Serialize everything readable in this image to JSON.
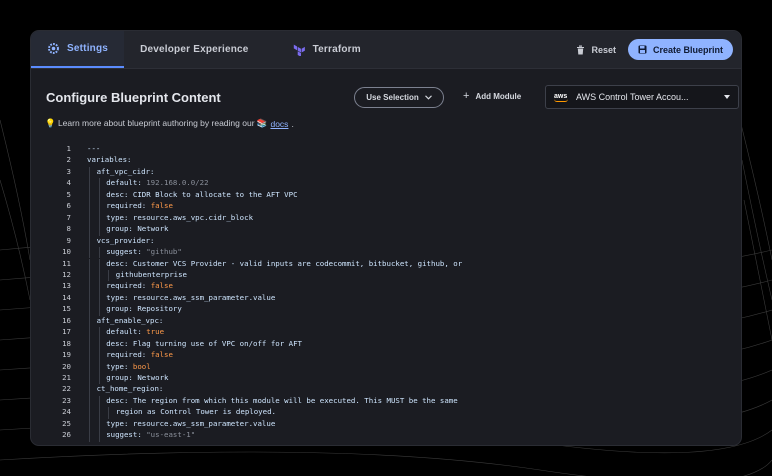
{
  "tabs": [
    {
      "label": "Settings",
      "icon": "gear-icon",
      "active": true
    },
    {
      "label": "Developer Experience",
      "icon": "",
      "active": false
    },
    {
      "label": "Terraform",
      "icon": "terraform-icon",
      "active": false
    }
  ],
  "actions": {
    "reset_label": "Reset",
    "create_label": "Create Blueprint"
  },
  "header": {
    "title": "Configure Blueprint Content",
    "use_selection_label": "Use Selection",
    "add_module_label": "Add Module",
    "module_selected": "AWS Control Tower Accou...",
    "module_logo_text": "aws"
  },
  "info": {
    "prefix": "💡 Learn more about blueprint authoring by reading our 📚",
    "link": "docs",
    "suffix": "."
  },
  "code_lines": [
    {
      "n": "1",
      "indent": 0,
      "parts": [
        [
          "k",
          "---"
        ]
      ]
    },
    {
      "n": "2",
      "indent": 0,
      "parts": [
        [
          "k",
          "variables:"
        ]
      ]
    },
    {
      "n": "3",
      "indent": 1,
      "parts": [
        [
          "k",
          "aft_vpc_cidr:"
        ]
      ]
    },
    {
      "n": "4",
      "indent": 2,
      "parts": [
        [
          "k",
          "default: "
        ],
        [
          "s",
          "192.168.0.0/22"
        ]
      ]
    },
    {
      "n": "5",
      "indent": 2,
      "parts": [
        [
          "k",
          "desc: CIDR Block to allocate to the AFT VPC"
        ]
      ]
    },
    {
      "n": "6",
      "indent": 2,
      "parts": [
        [
          "k",
          "required: "
        ],
        [
          "b",
          "false"
        ]
      ]
    },
    {
      "n": "7",
      "indent": 2,
      "parts": [
        [
          "k",
          "type: resource.aws_vpc.cidr_block"
        ]
      ]
    },
    {
      "n": "8",
      "indent": 2,
      "parts": [
        [
          "k",
          "group: Network"
        ]
      ]
    },
    {
      "n": "9",
      "indent": 1,
      "parts": [
        [
          "k",
          "vcs_provider:"
        ]
      ]
    },
    {
      "n": "10",
      "indent": 2,
      "parts": [
        [
          "k",
          "suggest: "
        ],
        [
          "s",
          "\"github\""
        ]
      ]
    },
    {
      "n": "11",
      "indent": 2,
      "parts": [
        [
          "k",
          "desc: Customer VCS Provider - valid inputs are codecommit, bitbucket, github, or"
        ]
      ]
    },
    {
      "n": "12",
      "indent": 3,
      "parts": [
        [
          "k",
          "githubenterprise"
        ]
      ]
    },
    {
      "n": "13",
      "indent": 2,
      "parts": [
        [
          "k",
          "required: "
        ],
        [
          "b",
          "false"
        ]
      ]
    },
    {
      "n": "14",
      "indent": 2,
      "parts": [
        [
          "k",
          "type: resource.aws_ssm_parameter.value"
        ]
      ]
    },
    {
      "n": "15",
      "indent": 2,
      "parts": [
        [
          "k",
          "group: Repository"
        ]
      ]
    },
    {
      "n": "16",
      "indent": 1,
      "parts": [
        [
          "k",
          "aft_enable_vpc:"
        ]
      ]
    },
    {
      "n": "17",
      "indent": 2,
      "parts": [
        [
          "k",
          "default: "
        ],
        [
          "b",
          "true"
        ]
      ]
    },
    {
      "n": "18",
      "indent": 2,
      "parts": [
        [
          "k",
          "desc: Flag turning use of VPC on/off for AFT"
        ]
      ]
    },
    {
      "n": "19",
      "indent": 2,
      "parts": [
        [
          "k",
          "required: "
        ],
        [
          "b",
          "false"
        ]
      ]
    },
    {
      "n": "20",
      "indent": 2,
      "parts": [
        [
          "k",
          "type: "
        ],
        [
          "b",
          "bool"
        ]
      ]
    },
    {
      "n": "21",
      "indent": 2,
      "parts": [
        [
          "k",
          "group: Network"
        ]
      ]
    },
    {
      "n": "22",
      "indent": 1,
      "parts": [
        [
          "k",
          "ct_home_region:"
        ]
      ]
    },
    {
      "n": "23",
      "indent": 2,
      "parts": [
        [
          "k",
          "desc: The region from which this module will be executed. This MUST be the same"
        ]
      ]
    },
    {
      "n": "24",
      "indent": 3,
      "parts": [
        [
          "k",
          "region as Control Tower is deployed."
        ]
      ]
    },
    {
      "n": "25",
      "indent": 2,
      "parts": [
        [
          "k",
          "type: resource.aws_ssm_parameter.value"
        ]
      ]
    },
    {
      "n": "26",
      "indent": 2,
      "parts": [
        [
          "k",
          "suggest: "
        ],
        [
          "s",
          "\"us-east-1\""
        ]
      ]
    }
  ],
  "colors": {
    "accent": "#8fb3ff",
    "panel": "#1b1c22",
    "boolean": "#ff9a4a"
  }
}
